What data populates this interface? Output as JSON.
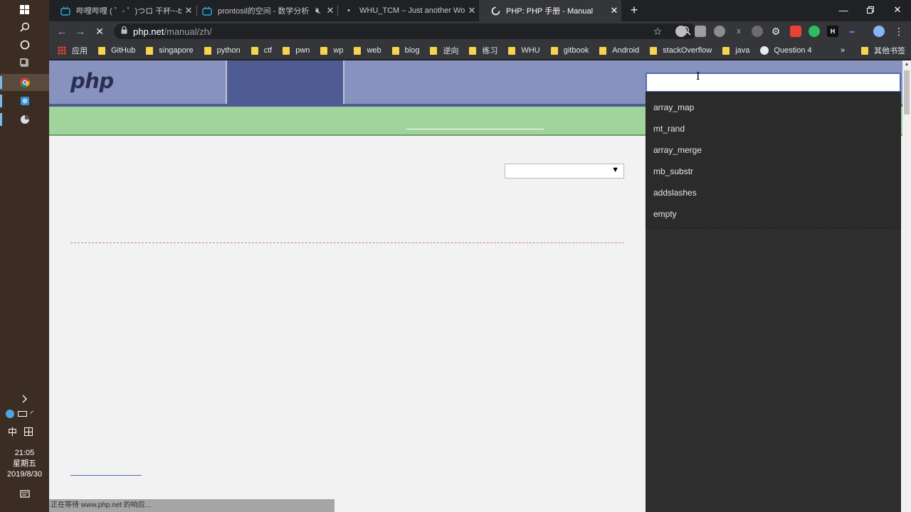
{
  "taskbar": {
    "icons": [
      "windows-start-icon",
      "search-icon",
      "cortana-icon",
      "task-view-icon"
    ],
    "apps": [
      "chrome-app-icon",
      "network-app-icon",
      "pinned-app-icon"
    ],
    "tray": {
      "ime": "中",
      "time": "21:05",
      "weekday": "星期五",
      "date": "2019/8/30"
    }
  },
  "tabs": [
    {
      "title": "哔哩哔哩 ( ゜- ゜)つロ 干杯~-bili",
      "favicon": "bilibili-icon"
    },
    {
      "title": "prontosil的空间 - 数学分析",
      "favicon": "bilibili-icon"
    },
    {
      "title": "WHU_TCM – Just another Wo",
      "favicon": "dot-icon"
    },
    {
      "title": "PHP: PHP 手册 - Manual",
      "favicon": "loading-icon"
    }
  ],
  "address": {
    "host": "php.net",
    "path": "/manual/zh/"
  },
  "bookmarks": [
    {
      "label": "应用",
      "type": "apps"
    },
    {
      "label": "GitHub",
      "type": "folder"
    },
    {
      "label": "singapore",
      "type": "folder"
    },
    {
      "label": "python",
      "type": "folder"
    },
    {
      "label": "ctf",
      "type": "folder"
    },
    {
      "label": "pwn",
      "type": "folder"
    },
    {
      "label": "wp",
      "type": "folder"
    },
    {
      "label": "web",
      "type": "folder"
    },
    {
      "label": "blog",
      "type": "folder"
    },
    {
      "label": "逆向",
      "type": "folder"
    },
    {
      "label": "练习",
      "type": "folder"
    },
    {
      "label": "WHU",
      "type": "folder"
    },
    {
      "label": "gitbook",
      "type": "folder"
    },
    {
      "label": "Android",
      "type": "folder"
    },
    {
      "label": "stackOverflow",
      "type": "folder"
    },
    {
      "label": "java",
      "type": "folder"
    },
    {
      "label": "Question 4",
      "type": "site"
    }
  ],
  "bookmarks_more": "»",
  "other_bookmarks": "其他书签",
  "php": {
    "logo": "php",
    "search_value": "",
    "suggestions": [
      "array_map",
      "mt_rand",
      "array_merge",
      "mb_substr",
      "addslashes",
      "empty"
    ]
  },
  "status": "正在等待 www.php.net 的响应...",
  "colors": {
    "php_header": "#8892bf",
    "php_nav_dark": "#4f5b93",
    "php_green": "#a1d49b"
  }
}
